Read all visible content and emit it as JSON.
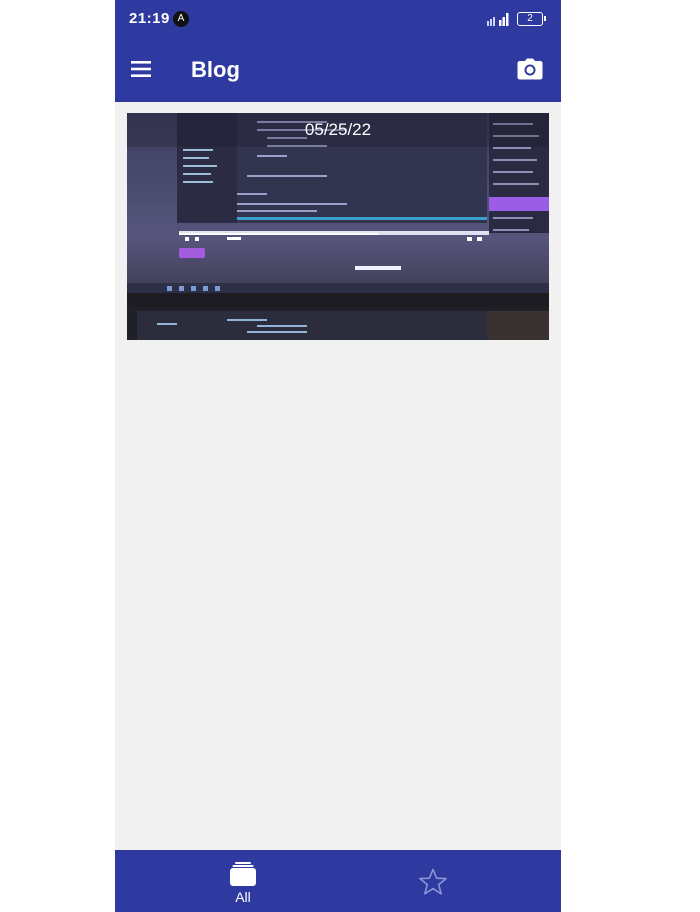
{
  "status_bar": {
    "time": "21:19",
    "app_icon_glyph": "A",
    "battery_level": "2"
  },
  "app_bar": {
    "title": "Blog",
    "menu_icon": "hamburger-menu-icon",
    "camera_icon": "camera-icon"
  },
  "posts": [
    {
      "date": "05/25/22",
      "photo_description_icon": "photo-of-monitor"
    }
  ],
  "bottom_nav": {
    "items": [
      {
        "label": "All",
        "icon": "stack-icon",
        "selected": true
      },
      {
        "label": "",
        "icon": "star-outline-icon",
        "selected": false
      }
    ]
  },
  "colors": {
    "primary": "#2e3a9f",
    "background": "#f1f1f1",
    "on_primary": "#ffffff"
  }
}
